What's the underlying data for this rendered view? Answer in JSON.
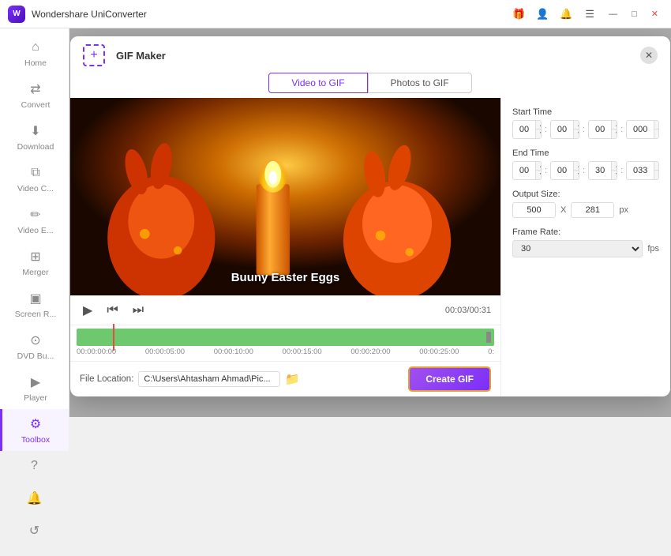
{
  "app": {
    "title": "Wondershare UniConverter",
    "logo_text": "W"
  },
  "titlebar": {
    "minimize": "—",
    "maximize": "□",
    "close": "✕",
    "icons": [
      "🎁",
      "👤",
      "🔔",
      "☰"
    ]
  },
  "sidebar": {
    "items": [
      {
        "id": "home",
        "label": "Home",
        "icon": "⌂"
      },
      {
        "id": "convert",
        "label": "Convert",
        "icon": "⇄"
      },
      {
        "id": "download",
        "label": "Download",
        "icon": "⬇"
      },
      {
        "id": "video-compress",
        "label": "Video C...",
        "icon": "⧉"
      },
      {
        "id": "video-edit",
        "label": "Video E...",
        "icon": "✏"
      },
      {
        "id": "merger",
        "label": "Merger",
        "icon": "⊞"
      },
      {
        "id": "screen",
        "label": "Screen R...",
        "icon": "▣"
      },
      {
        "id": "dvd",
        "label": "DVD Bu...",
        "icon": "⊙"
      },
      {
        "id": "player",
        "label": "Player",
        "icon": "▶"
      },
      {
        "id": "toolbox",
        "label": "Toolbox",
        "icon": "⚙"
      }
    ],
    "bottom": [
      {
        "id": "help",
        "icon": "?"
      },
      {
        "id": "bell",
        "icon": "🔔"
      },
      {
        "id": "refresh",
        "icon": "↺"
      }
    ]
  },
  "modal": {
    "title": "GIF Maker",
    "close_label": "✕",
    "tabs": [
      {
        "id": "video-to-gif",
        "label": "Video to GIF",
        "active": true
      },
      {
        "id": "photos-to-gif",
        "label": "Photos to GIF",
        "active": false
      }
    ],
    "video": {
      "title": "Buuny Easter Eggs",
      "time_current": "00:03",
      "time_total": "00:31"
    },
    "controls": {
      "play": "▶",
      "prev": "⏮",
      "next": "⏭"
    },
    "timeline": {
      "labels": [
        "00:00:00:00",
        "00:00:05:00",
        "00:00:10:00",
        "00:00:15:00",
        "00:00:20:00",
        "00:00:25:00",
        "0:"
      ]
    },
    "right_panel": {
      "start_time_label": "Start Time",
      "end_time_label": "End Time",
      "output_size_label": "Output Size:",
      "frame_rate_label": "Frame Rate:",
      "start_h": "00",
      "start_m": "00",
      "start_s": "00",
      "start_ms": "000",
      "end_h": "00",
      "end_m": "00",
      "end_s": "30",
      "end_ms": "033",
      "width": "500",
      "height": "281",
      "size_x": "X",
      "size_px": "px",
      "fps": "30",
      "fps_unit": "fps"
    },
    "file_location": {
      "label": "File Location:",
      "path": "C:\\Users\\Ahtasham Ahmad\\Pic..."
    },
    "create_gif_btn": "Create GIF"
  }
}
